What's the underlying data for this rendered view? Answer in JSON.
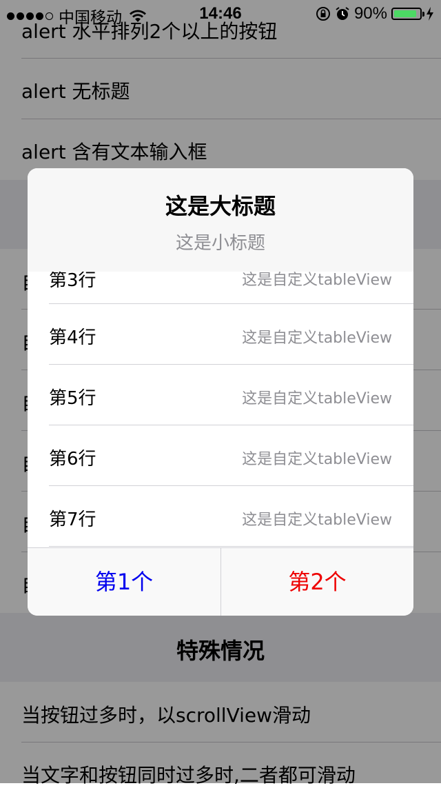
{
  "status_bar": {
    "carrier": "中国移动",
    "time": "14:46",
    "battery": "90%",
    "battery_fill": 0.9
  },
  "background_list": {
    "rows_top": [
      "alert 水平排列2个以上的按钮",
      "alert 无标题",
      "alert 含有文本输入框"
    ],
    "partial_rows": [
      "自",
      "自",
      "自",
      "自",
      "自",
      "自"
    ],
    "section_title": "特殊情况",
    "rows_bottom": [
      "当按钮过多时，以scrollView滑动",
      "当文字和按钮同时过多时,二者都可滑动"
    ]
  },
  "alert": {
    "title": "这是大标题",
    "subtitle": "这是小标题",
    "table_rows": [
      {
        "left": "第3行",
        "right": "这是自定义tableView"
      },
      {
        "left": "第4行",
        "right": "这是自定义tableView"
      },
      {
        "left": "第5行",
        "right": "这是自定义tableView"
      },
      {
        "left": "第6行",
        "right": "这是自定义tableView"
      },
      {
        "left": "第7行",
        "right": "这是自定义tableView"
      }
    ],
    "buttons": [
      {
        "label": "第1个",
        "color": "#0000ee"
      },
      {
        "label": "第2个",
        "color": "#ee0000"
      }
    ]
  }
}
